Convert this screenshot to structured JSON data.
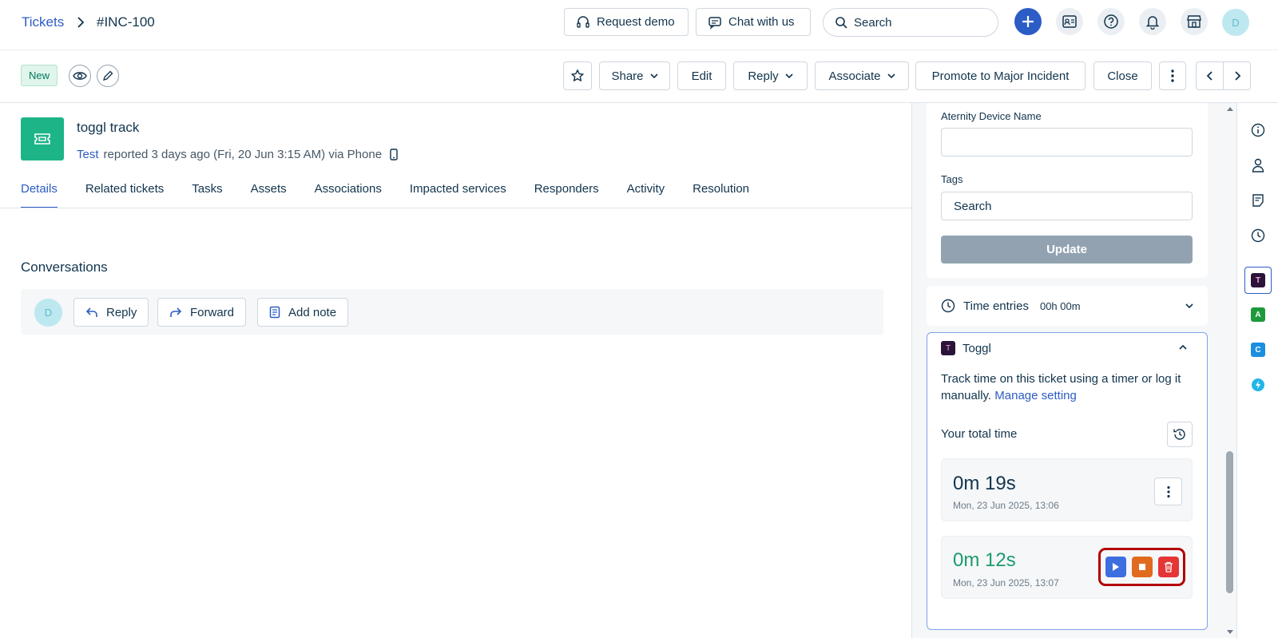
{
  "breadcrumb": {
    "root": "Tickets",
    "current": "#INC-100"
  },
  "header": {
    "request_demo": "Request demo",
    "chat_with_us": "Chat with us",
    "search_placeholder": "Search",
    "avatar_initial": "D",
    "icons": [
      "plus-icon",
      "contact-card-icon",
      "help-icon",
      "bell-icon",
      "store-icon"
    ]
  },
  "actionbar": {
    "status": "New",
    "share": "Share",
    "edit": "Edit",
    "reply": "Reply",
    "associate": "Associate",
    "promote": "Promote to Major Incident",
    "close": "Close"
  },
  "ticket": {
    "title": "toggl track",
    "reporter": "Test",
    "reported_text": "reported 3 days ago (Fri, 20 Jun 3:15 AM) via Phone"
  },
  "tabs": [
    "Details",
    "Related tickets",
    "Tasks",
    "Assets",
    "Associations",
    "Impacted services",
    "Responders",
    "Activity",
    "Resolution"
  ],
  "conversations": {
    "title": "Conversations",
    "avatar_initial": "D",
    "reply": "Reply",
    "forward": "Forward",
    "add_note": "Add note"
  },
  "properties": {
    "device_label": "Aternity Device Name",
    "device_value": "",
    "tags_label": "Tags",
    "tags_placeholder": "Search",
    "update": "Update"
  },
  "time_entries": {
    "label": "Time entries",
    "value": "00h 00m"
  },
  "toggl": {
    "title": "Toggl",
    "logo_letter": "T",
    "description": "Track time on this ticket using a timer or log it manually.",
    "manage_link": "Manage setting",
    "total_label": "Your total time",
    "entries": [
      {
        "time": "0m 19s",
        "date": "Mon, 23 Jun 2025, 13:06",
        "color": "#12344d"
      },
      {
        "time": "0m 12s",
        "date": "Mon, 23 Jun 2025, 13:07",
        "color": "#1d9a6c"
      }
    ],
    "controls_highlight_color": "#b30000"
  },
  "rail": {
    "apps": [
      "T",
      "A",
      "C"
    ]
  }
}
